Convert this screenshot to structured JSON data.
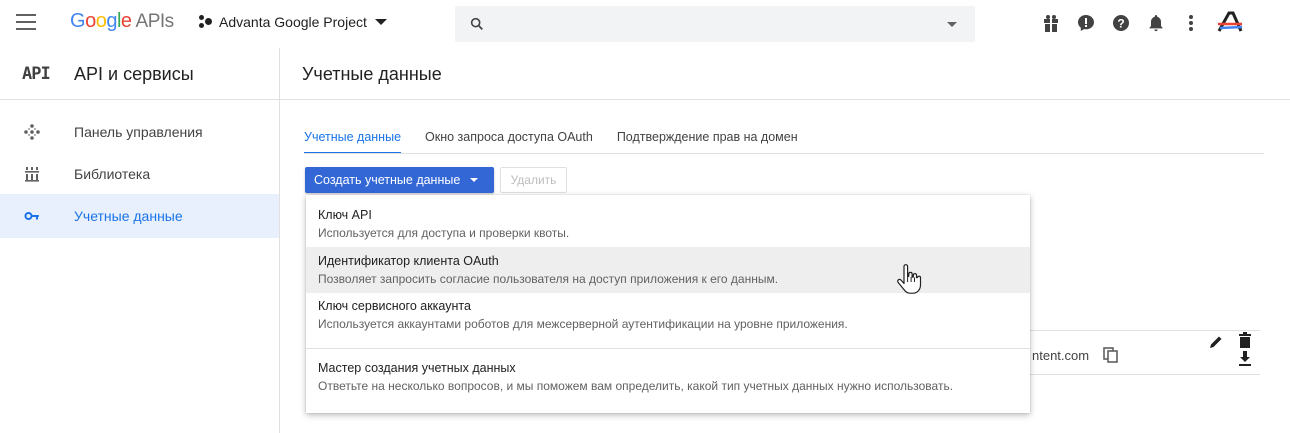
{
  "topbar": {
    "logo_letters": [
      "G",
      "o",
      "o",
      "g",
      "l",
      "e"
    ],
    "logo_suffix": "APIs",
    "project_name": "Advanta Google Project",
    "icons": [
      "gift-icon",
      "feedback-icon",
      "help-icon",
      "notifications-icon",
      "more-vert-icon",
      "avatar-icon"
    ]
  },
  "header": {
    "api_badge": "API",
    "api_title": "API и сервисы",
    "page_title": "Учетные данные"
  },
  "sidebar": {
    "items": [
      {
        "label": "Панель управления",
        "icon": "dashboard-icon"
      },
      {
        "label": "Библиотека",
        "icon": "library-icon"
      },
      {
        "label": "Учетные данные",
        "icon": "key-icon",
        "active": true
      }
    ]
  },
  "tabs": [
    {
      "label": "Учетные данные",
      "active": true
    },
    {
      "label": "Окно запроса доступа OAuth"
    },
    {
      "label": "Подтверждение прав на домен"
    }
  ],
  "toolbar": {
    "create_label": "Создать учетные данные",
    "delete_label": "Удалить"
  },
  "menu": {
    "items": [
      {
        "title": "Ключ API",
        "desc": "Используется для доступа и проверки квоты."
      },
      {
        "title": "Идентификатор клиента OAuth",
        "desc": "Позволяет запросить согласие пользователя на доступ приложения к его данным.",
        "hover": true
      },
      {
        "title": "Ключ сервисного аккаунта",
        "desc": "Используется аккаунтами роботов для межсерверной аутентификации на уровне приложения."
      },
      {
        "title": "Мастер создания учетных данных",
        "desc": "Ответьте на несколько вопросов, и мы поможем вам определить, какой тип учетных данных нужно использовать."
      }
    ]
  },
  "table": {
    "client_id_fragment": "ntent.com"
  },
  "colors": {
    "accent": "#1a73e8",
    "button": "#3367d6",
    "active_bg": "#e8f0fe"
  }
}
